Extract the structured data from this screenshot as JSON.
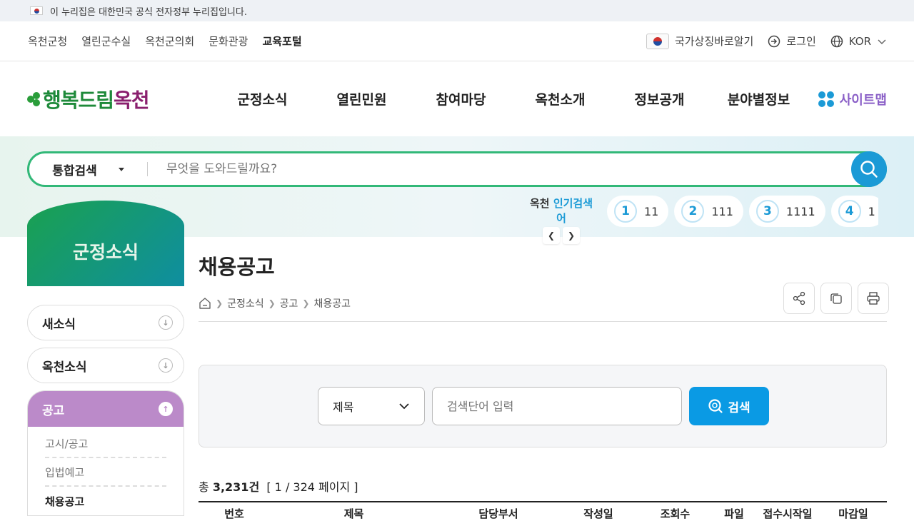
{
  "gov_banner": {
    "text": "이 누리집은 대한민국 공식 전자정부 누리집입니다."
  },
  "util_links": [
    "옥천군청",
    "열린군수실",
    "옥천군의회",
    "문화관광",
    "교육포털"
  ],
  "util_right": {
    "symbol": "국가상징바로알기",
    "login": "로그인",
    "lang": "KOR"
  },
  "logo": {
    "part1": "행복드림",
    "part2": "옥천"
  },
  "nav": [
    "군정소식",
    "열린민원",
    "참여마당",
    "옥천소개",
    "정보공개",
    "분야별정보"
  ],
  "sitemap": "사이트맵",
  "search": {
    "type": "통합검색",
    "placeholder": "무엇을 도와드릴까요?"
  },
  "popular": {
    "prefix": "옥천",
    "label": "인기검색어",
    "items": [
      {
        "rank": "1",
        "term": "11"
      },
      {
        "rank": "2",
        "term": "111"
      },
      {
        "rank": "3",
        "term": "1111"
      },
      {
        "rank": "4",
        "term": "1"
      }
    ]
  },
  "sidebar": {
    "title": "군정소식",
    "items": [
      "새소식",
      "옥천소식"
    ],
    "active": "공고",
    "sub": [
      "고시/공고",
      "입법예고",
      "채용공고"
    ]
  },
  "page": {
    "title": "채용공고",
    "breadcrumb": [
      "군정소식",
      "공고",
      "채용공고"
    ]
  },
  "board_search": {
    "field": "제목",
    "placeholder": "검색단어 입력",
    "button": "검색"
  },
  "summary": {
    "total_prefix": "총",
    "total": "3,231건",
    "pages": "[ 1 / 324 페이지 ]"
  },
  "table_headers": [
    "번호",
    "제목",
    "담당부서",
    "작성일",
    "조회수",
    "파일",
    "접수시작일",
    "마감일"
  ],
  "colors": {
    "accent": "#1b9ad6",
    "green": "#32b878",
    "purple": "#bb8ac9"
  }
}
